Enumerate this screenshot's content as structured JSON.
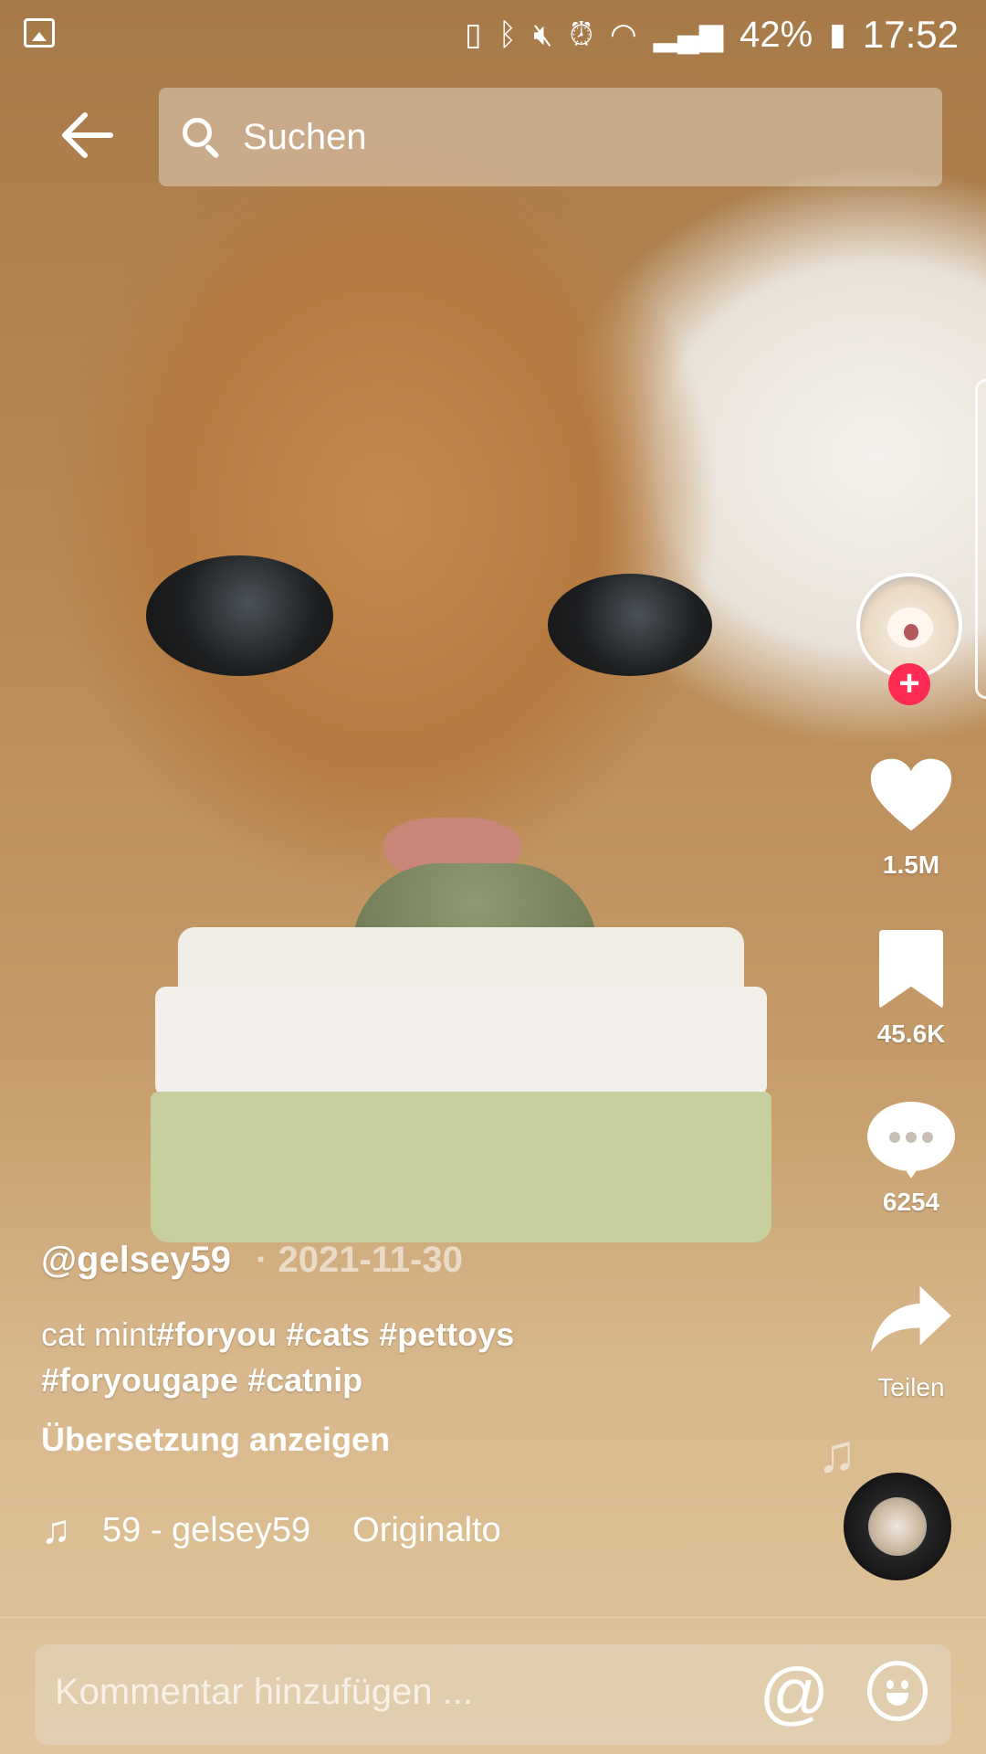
{
  "status_bar": {
    "battery": "42%",
    "time": "17:52",
    "icons": [
      "image-icon",
      "battery-saver-icon",
      "bluetooth-icon",
      "mute-icon",
      "alarm-icon",
      "wifi-icon",
      "signal-icon",
      "battery-icon"
    ]
  },
  "top_bar": {
    "back_icon": "arrow-left-icon",
    "search_placeholder": "Suchen"
  },
  "rail": {
    "likes": "1.5M",
    "bookmarks": "45.6K",
    "comments": "6254",
    "share_label": "Teilen"
  },
  "post": {
    "username": "@gelsey59",
    "date_sep": "·",
    "date": "2021-11-30",
    "caption_text": "cat mint",
    "hashtags": [
      "#foryou",
      "#cats",
      "#pettoys",
      "#foryougape",
      "#catnip"
    ],
    "translate_label": "Übersetzung anzeigen",
    "music_author": "59 - gelsey59",
    "music_title": "Originalto"
  },
  "comment_bar": {
    "placeholder": "Kommentar hinzufügen ..."
  },
  "colors": {
    "follow_accent": "#fe2c55"
  }
}
